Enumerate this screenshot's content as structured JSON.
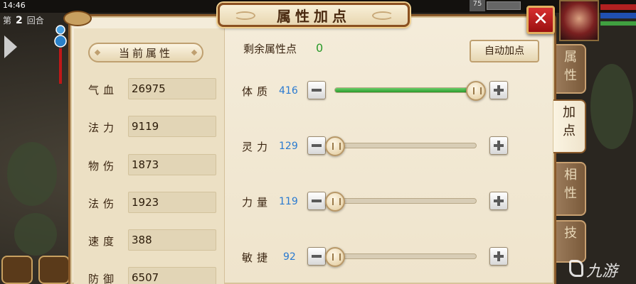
{
  "status_bar": {
    "time": "14:46"
  },
  "battle": {
    "round_prefix": "第",
    "round_number": "2",
    "round_suffix": "回合",
    "hud_number": "75"
  },
  "panel": {
    "title": "属性加点",
    "close_label": "✕"
  },
  "current_attributes": {
    "header": "当前属性",
    "items": [
      {
        "label": "气血",
        "value": "26975"
      },
      {
        "label": "法力",
        "value": "9119"
      },
      {
        "label": "物伤",
        "value": "1873"
      },
      {
        "label": "法伤",
        "value": "1923"
      },
      {
        "label": "速度",
        "value": "388"
      },
      {
        "label": "防御",
        "value": "6507"
      }
    ]
  },
  "allocation": {
    "remaining_label": "剩余属性点",
    "remaining_value": "0",
    "auto_button": "自动加点",
    "stats": [
      {
        "label": "体质",
        "value": "416",
        "fill": 1.0
      },
      {
        "label": "灵力",
        "value": "129",
        "fill": 0.0
      },
      {
        "label": "力量",
        "value": "119",
        "fill": 0.0
      },
      {
        "label": "敏捷",
        "value": "92",
        "fill": 0.0
      }
    ]
  },
  "side_tabs": [
    {
      "label": "属\n性",
      "active": false
    },
    {
      "label": "加\n点",
      "active": true
    },
    {
      "label": "相\n性",
      "active": false
    },
    {
      "label": "技",
      "active": false
    }
  ],
  "watermark": "九游",
  "colors": {
    "remaining": "#2a9a2a",
    "stat_value": "#2a7ad0",
    "close_button": "#c82020",
    "slider_fill": "#2a9a2a"
  }
}
